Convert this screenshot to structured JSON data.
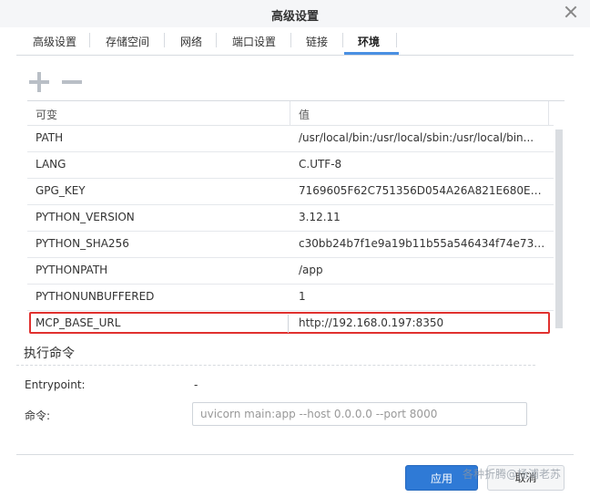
{
  "window": {
    "title": "高级设置"
  },
  "tabs": [
    "高级设置",
    "存储空间",
    "网络",
    "端口设置",
    "链接",
    "环境"
  ],
  "active_tab": "环境",
  "table": {
    "headers": [
      "可变",
      "值"
    ],
    "rows": [
      {
        "key": "PATH",
        "value": "/usr/local/bin:/usr/local/sbin:/usr/local/bin..."
      },
      {
        "key": "LANG",
        "value": "C.UTF-8"
      },
      {
        "key": "GPG_KEY",
        "value": "7169605F62C751356D054A26A821E680E5..."
      },
      {
        "key": "PYTHON_VERSION",
        "value": "3.12.11"
      },
      {
        "key": "PYTHON_SHA256",
        "value": "c30bb24b7f1e9a19b11b55a546434f74e739..."
      },
      {
        "key": "PYTHONPATH",
        "value": "/app"
      },
      {
        "key": "PYTHONUNBUFFERED",
        "value": "1"
      },
      {
        "key": "MCP_BASE_URL",
        "value": "http://192.168.0.197:8350"
      }
    ]
  },
  "exec": {
    "section_title": "执行命令",
    "entrypoint_label": "Entrypoint:",
    "entrypoint_value": "-",
    "command_label": "命令:",
    "command_value": "uvicorn main:app --host 0.0.0.0 --port 8000"
  },
  "footer": {
    "apply": "应用",
    "cancel": "取消"
  },
  "watermark": "各种折腾@杨浦老苏",
  "colors": {
    "accent": "#2f7ad6",
    "highlight": "#e0312f"
  }
}
